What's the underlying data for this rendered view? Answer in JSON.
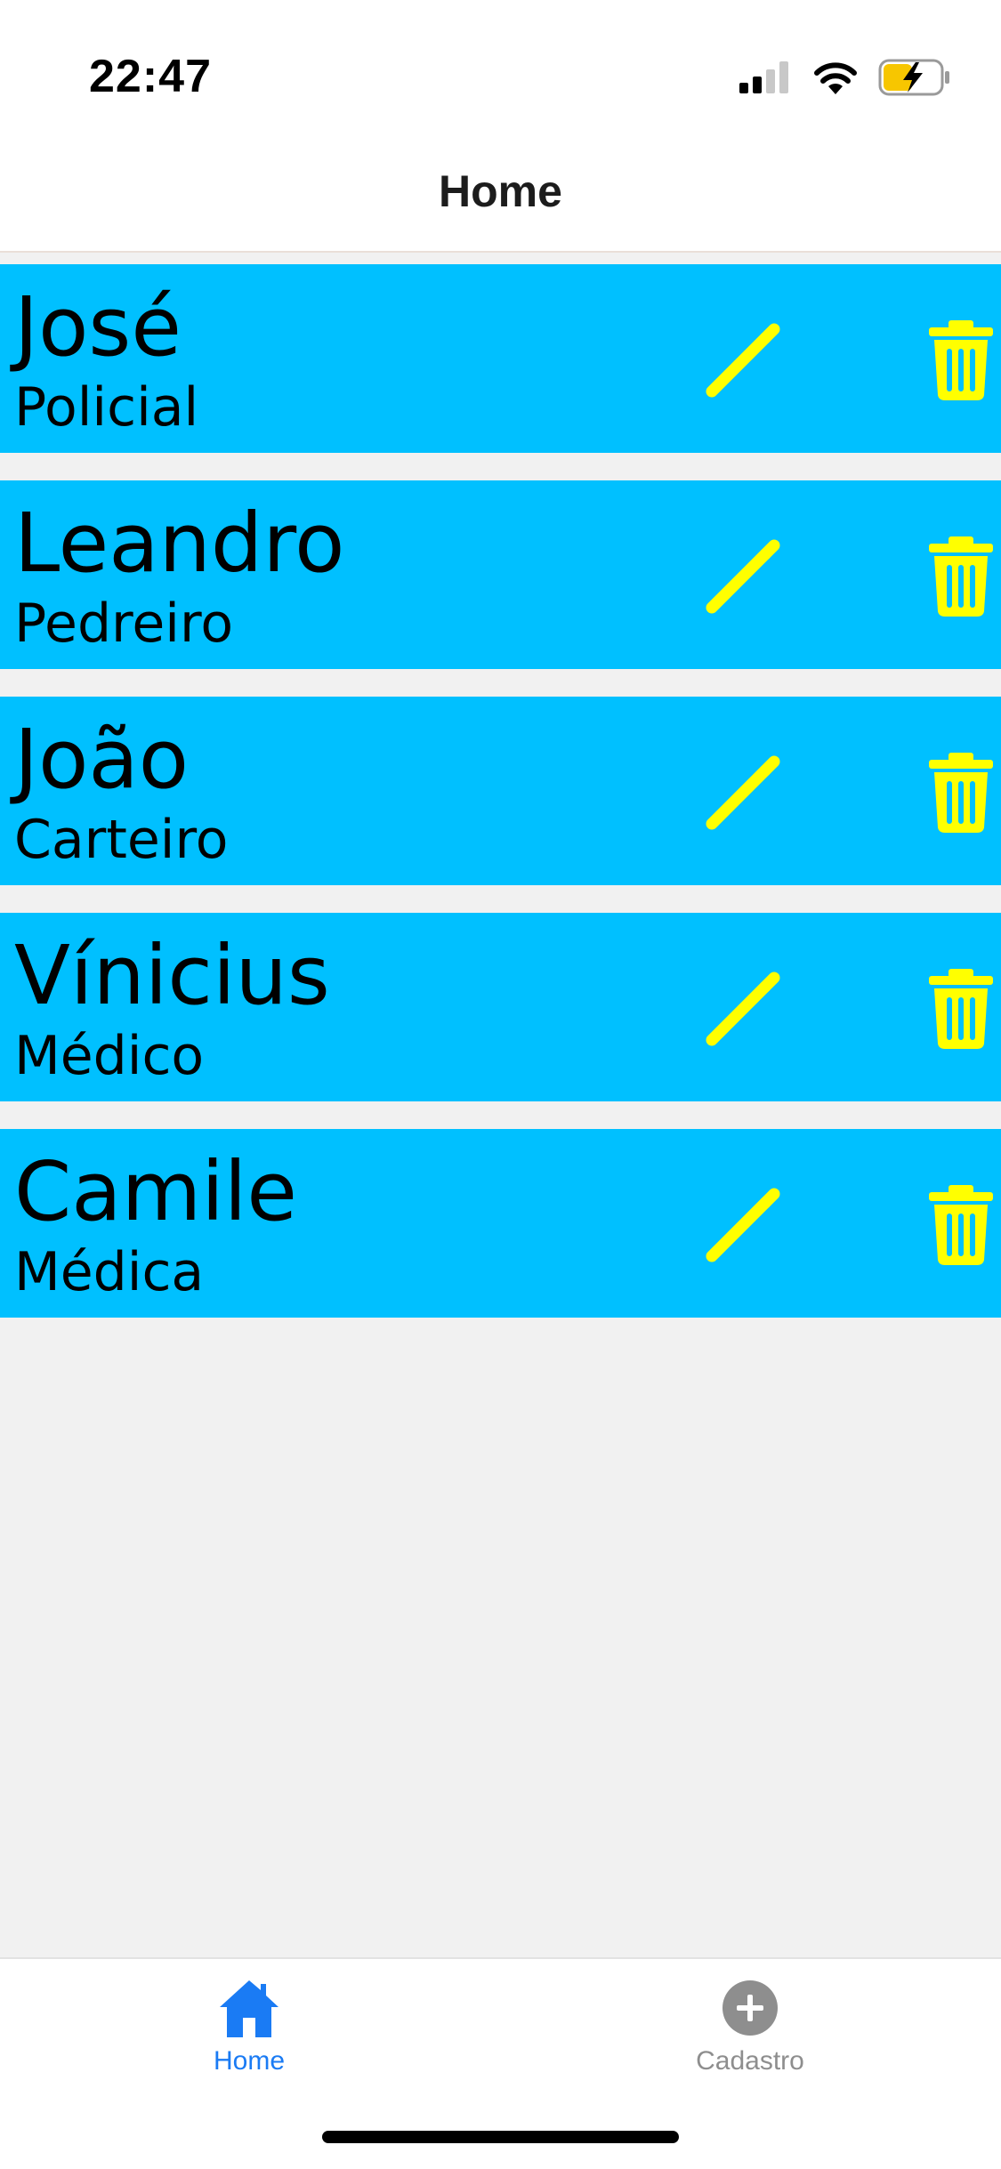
{
  "status": {
    "time": "22:47"
  },
  "header": {
    "title": "Home"
  },
  "colors": {
    "item_bg": "#00c0ff",
    "icon": "#ffff00",
    "tab_active": "#1a7bf4",
    "tab_inactive": "#8e8e8e"
  },
  "items": [
    {
      "name": "José",
      "role": "Policial"
    },
    {
      "name": "Leandro",
      "role": "Pedreiro"
    },
    {
      "name": "João",
      "role": "Carteiro"
    },
    {
      "name": "Vínicius",
      "role": "Médico"
    },
    {
      "name": "Camile",
      "role": "Médica"
    }
  ],
  "tabs": [
    {
      "label": "Home",
      "icon": "home-icon",
      "active": true
    },
    {
      "label": "Cadastro",
      "icon": "plus-circle-icon",
      "active": false
    }
  ]
}
